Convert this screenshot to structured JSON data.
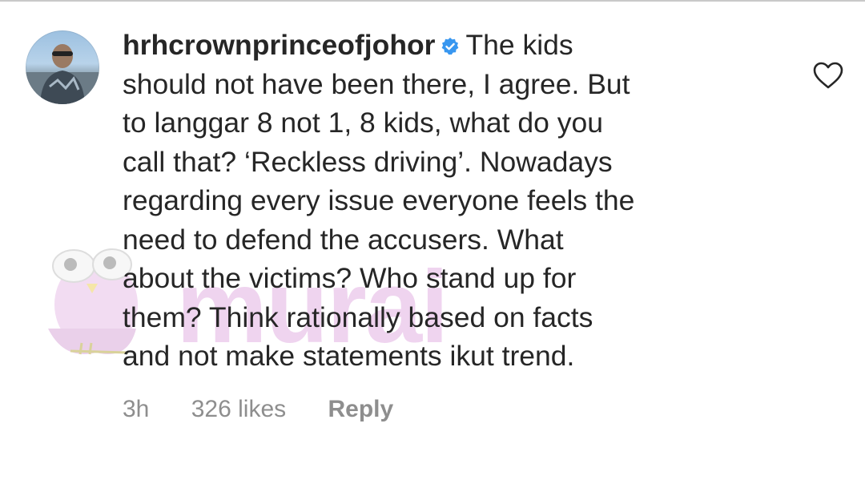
{
  "comment": {
    "username": "hrhcrownprinceofjohor",
    "verified": true,
    "text_lines": [
      "The kids",
      "should not have been there, I agree. But",
      "to langgar 8 not 1, 8 kids, what do you",
      "call that? ‘Reckless driving’. Nowadays",
      "regarding every issue everyone feels the",
      "need to defend the accusers. What",
      "about the victims? Who stand up for",
      "them? Think rationally based on facts",
      "and not make statements ikut trend."
    ],
    "time": "3h",
    "likes": "326 likes",
    "reply_label": "Reply"
  },
  "watermark": {
    "text": "murai"
  },
  "icons": {
    "verified": "verified-badge-icon",
    "like": "heart-icon"
  },
  "colors": {
    "text": "#262626",
    "meta": "#8e8e8e",
    "verified": "#3897f0",
    "watermark": "#efd4ef"
  }
}
